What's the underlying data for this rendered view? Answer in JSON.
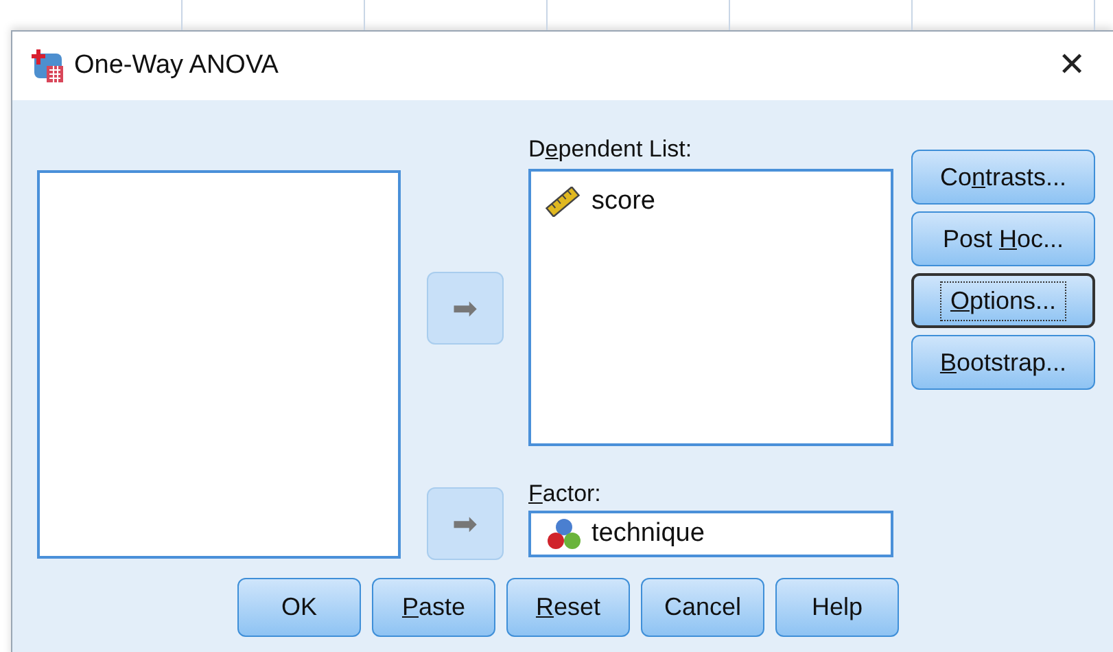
{
  "window": {
    "title": "One-Way ANOVA",
    "close_label": "✕"
  },
  "arrow_buttons": [
    {
      "label": "➡",
      "disabled": true
    },
    {
      "label": "➡",
      "disabled": true
    }
  ],
  "dependent_list": {
    "label": {
      "before": "D",
      "shortcut": "e",
      "after": "pendent List:"
    },
    "items": [
      {
        "kind": "scale",
        "name": "score"
      }
    ]
  },
  "factor": {
    "label": {
      "shortcut": "F",
      "after": "actor:"
    },
    "value": "technique",
    "kind": "nominal"
  },
  "side_buttons": [
    {
      "label": {
        "before": "Co",
        "shortcut": "n",
        "after": "trasts..."
      },
      "focused": false
    },
    {
      "label": {
        "before": "Post ",
        "shortcut": "H",
        "after": "oc..."
      },
      "focused": false
    },
    {
      "label": {
        "shortcut": "O",
        "after": "ptions..."
      },
      "focused": true
    },
    {
      "label": {
        "shortcut": "B",
        "after": "ootstrap..."
      },
      "focused": false
    }
  ],
  "bottom_buttons": [
    {
      "label": {
        "before": "OK"
      },
      "focused": false
    },
    {
      "label": {
        "shortcut": "P",
        "after": "aste"
      },
      "focused": false
    },
    {
      "label": {
        "shortcut": "R",
        "after": "eset"
      },
      "focused": false
    },
    {
      "label": {
        "before": "Cancel"
      },
      "focused": false
    },
    {
      "label": {
        "before": "Help"
      },
      "focused": false
    }
  ]
}
